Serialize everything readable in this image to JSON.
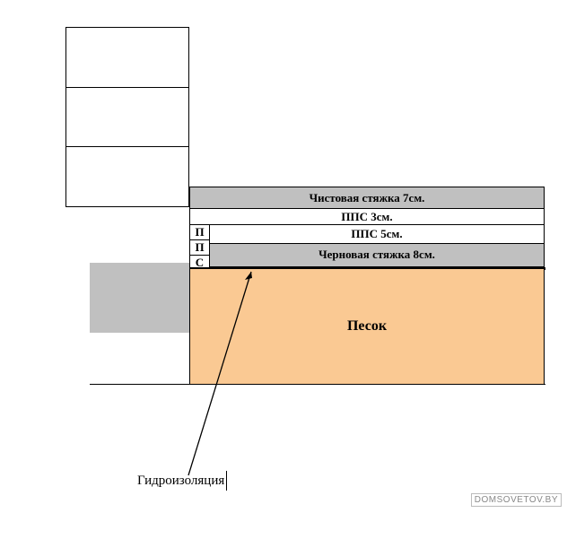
{
  "layers": {
    "finish_screed": "Чистовая стяжка 7см.",
    "pps3": "ППС 3см.",
    "pps5": "ППС 5см.",
    "rough_screed": "Черновая стяжка 8см.",
    "side_letters": [
      "П",
      "П",
      "С"
    ],
    "sand": "Песок",
    "hydro": "Гидроизоляция"
  },
  "watermark": "DOMSOVETOV.BY"
}
